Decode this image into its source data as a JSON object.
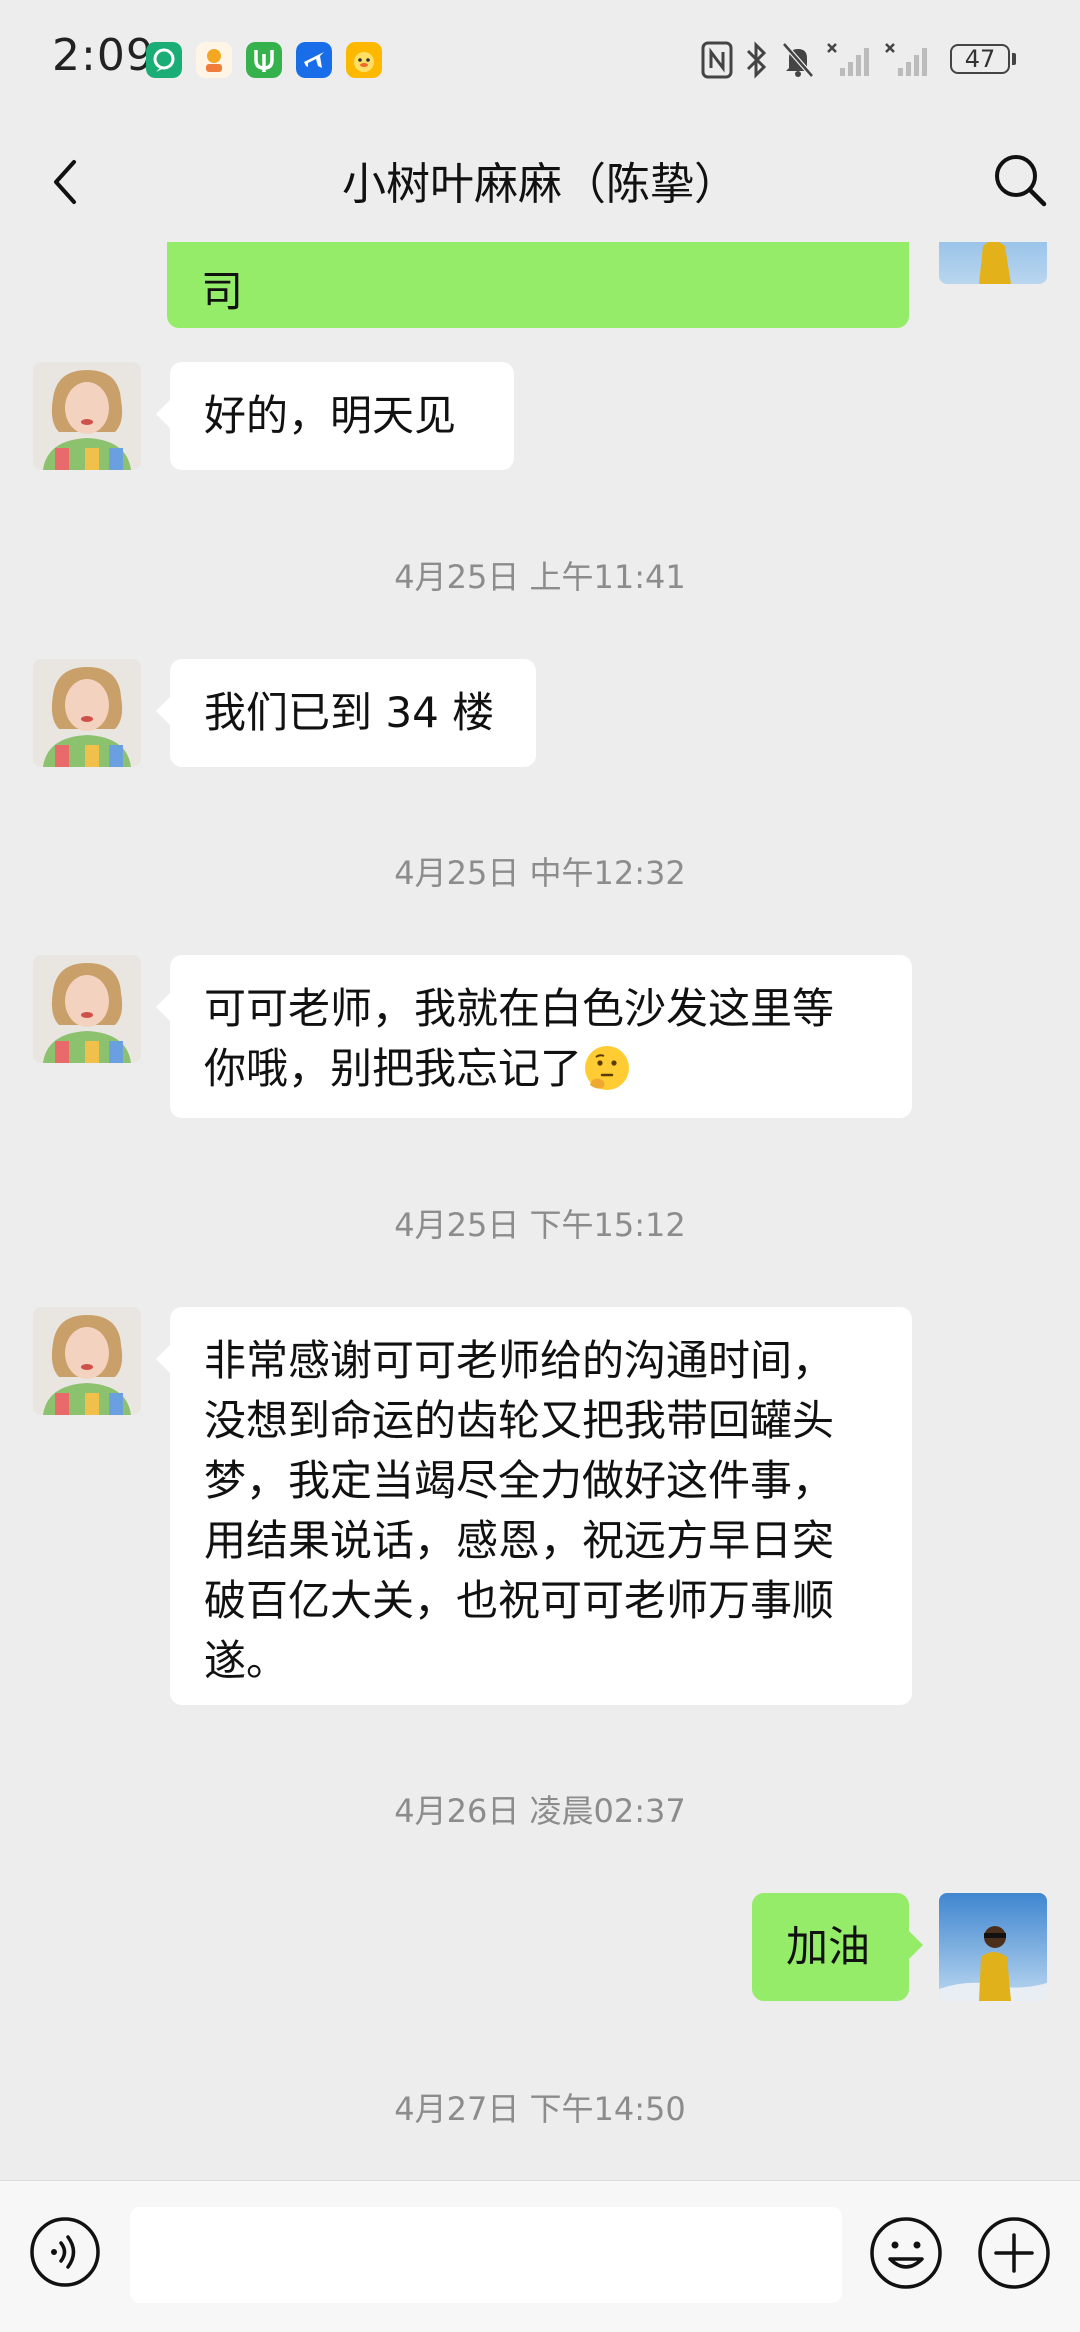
{
  "status_bar": {
    "time": "2:09",
    "battery": "47",
    "app_icons": [
      "wechat-work-icon",
      "kid-app-icon",
      "tree-app-icon",
      "travel-app-icon",
      "duck-app-icon"
    ],
    "system_icons": [
      "nfc-icon",
      "bluetooth-icon",
      "mute-icon",
      "signal-1-icon",
      "signal-2-icon",
      "battery-icon"
    ]
  },
  "nav": {
    "title": "小树叶麻麻（陈挚）",
    "back_icon": "chevron-left-icon",
    "search_icon": "search-icon"
  },
  "messages": [
    {
      "sender": "me",
      "text": "司"
    },
    {
      "sender": "contact",
      "text": "好的，明天见"
    },
    {
      "type": "time",
      "text": "4月25日 上午11:41"
    },
    {
      "sender": "contact",
      "text": "我们已到 34 楼"
    },
    {
      "type": "time",
      "text": "4月25日 中午12:32"
    },
    {
      "sender": "contact",
      "text_line1": "可可老师，我就在白色沙发这里等",
      "text_line2": "你哦，别把我忘记了",
      "emoji": "thinking-face-emoji"
    },
    {
      "type": "time",
      "text": "4月25日 下午15:12"
    },
    {
      "sender": "contact",
      "lines": [
        "非常感谢可可老师给的沟通时间，",
        "没想到命运的齿轮又把我带回罐头",
        "梦，我定当竭尽全力做好这件事，",
        "用结果说话，感恩，祝远方早日突",
        "破百亿大关，也祝可可老师万事顺",
        "遂。"
      ]
    },
    {
      "type": "time",
      "text": "4月26日 凌晨02:37"
    },
    {
      "sender": "me",
      "text": "加油"
    },
    {
      "type": "time",
      "text": "4月27日 下午14:50"
    }
  ],
  "input_bar": {
    "voice_icon": "voice-icon",
    "placeholder": "",
    "emoji_icon": "emoji-icon",
    "plus_icon": "plus-icon"
  },
  "colors": {
    "background": "#ededed",
    "bubble_me": "#95ec69",
    "bubble_contact": "#ffffff",
    "timestamp": "#8c8c8c"
  }
}
